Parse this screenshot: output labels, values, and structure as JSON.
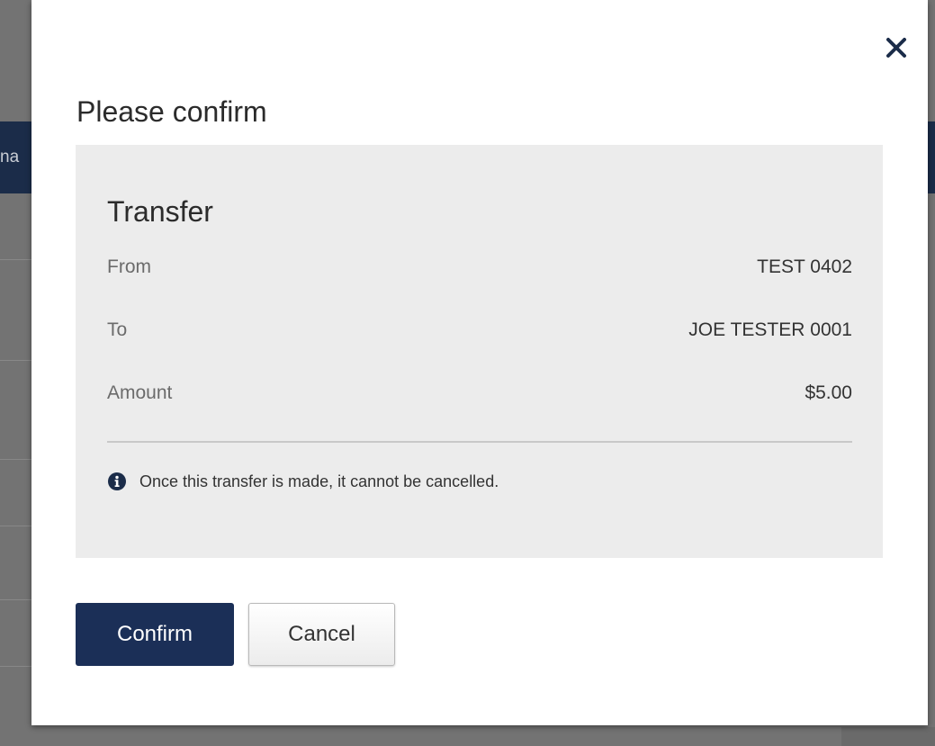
{
  "background": {
    "nav_fragment": "na"
  },
  "modal": {
    "title": "Please confirm",
    "close_label": "×",
    "summary": {
      "heading": "Transfer",
      "rows": [
        {
          "label": "From",
          "value": "TEST 0402"
        },
        {
          "label": "To",
          "value": "JOE TESTER 0001"
        },
        {
          "label": "Amount",
          "value": "$5.00"
        }
      ],
      "notice": "Once this transfer is made, it cannot be cancelled.",
      "notice_icon": "info-circle-icon"
    },
    "buttons": {
      "confirm": "Confirm",
      "cancel": "Cancel"
    }
  },
  "colors": {
    "primary": "#1b2f57",
    "summary_bg": "#ececec",
    "overlay": "#737373"
  }
}
